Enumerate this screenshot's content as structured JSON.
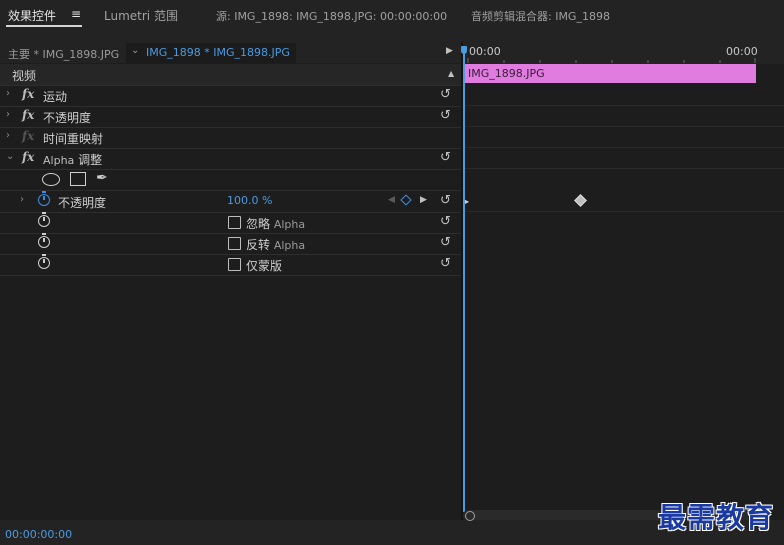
{
  "tabs": {
    "effect_controls": "效果控件",
    "menu_icon": "≡",
    "lumetri": "Lumetri 范围",
    "source": "源: IMG_1898: IMG_1898.JPG: 00:00:00:00",
    "mixer": "音频剪辑混合器: IMG_1898"
  },
  "clip_header": {
    "master": "主要 * IMG_1898.JPG",
    "sequence": "IMG_1898 * IMG_1898.JPG"
  },
  "timeline": {
    "start_time": "00:00",
    "end_time": "00:00",
    "clip_name": "IMG_1898.JPG"
  },
  "sections": {
    "video": "视频",
    "motion": "运动",
    "opacity": "不透明度",
    "time_remap": "时间重映射",
    "alpha_adjust_en": "Alpha",
    "alpha_adjust_zh": "调整"
  },
  "params": {
    "opacity_label": "不透明度",
    "opacity_value": "100.0 %",
    "ignore_alpha_zh": "忽略",
    "invert_alpha_zh": "反转",
    "alpha_en": "Alpha",
    "mask_only": "仅蒙版"
  },
  "fx_symbol": "fx",
  "timecode": "00:00:00:00",
  "watermark": "最需教育",
  "icons": {
    "chevron": "›",
    "expanded": "⌄",
    "reset": "↺",
    "pen": "✒",
    "up": "▲",
    "play": "▶",
    "left": "◀"
  }
}
